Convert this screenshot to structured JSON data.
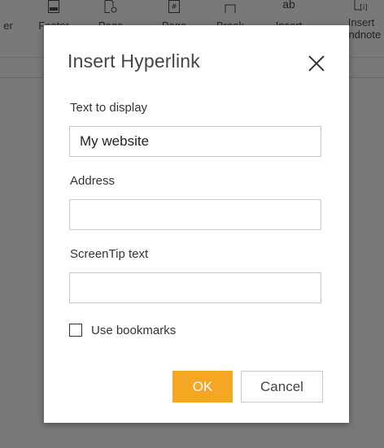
{
  "ribbon": {
    "items": [
      {
        "label": "er",
        "icon": "ribbon-partial-icon"
      },
      {
        "label": "Footer",
        "icon": "footer-icon"
      },
      {
        "label": "Page",
        "icon": "page-setup-icon"
      },
      {
        "label": "Page",
        "icon": "page-number-icon"
      },
      {
        "label": "Break",
        "icon": "break-icon"
      },
      {
        "label": "Insert",
        "icon": "text-box-icon"
      },
      {
        "label": "Insert\nEndnote",
        "icon": "endnote-icon"
      }
    ]
  },
  "dialog": {
    "title": "Insert Hyperlink",
    "text_label": "Text to display",
    "text_value": "My website",
    "address_label": "Address",
    "address_value": "",
    "screentip_label": "ScreenTip text",
    "screentip_value": "",
    "bookmarks_label": "Use bookmarks",
    "bookmarks_checked": false,
    "ok_label": "OK",
    "cancel_label": "Cancel"
  },
  "colors": {
    "accent": "#f5a623",
    "overlay": "rgba(0,0,0,0.5)"
  }
}
